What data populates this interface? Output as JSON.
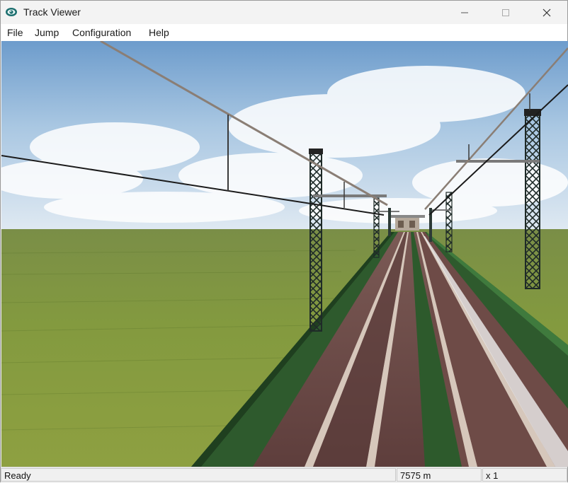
{
  "window": {
    "title": "Track Viewer",
    "icon": "track-viewer-eye-icon",
    "controls": [
      "minimize-icon",
      "maximize-icon",
      "close-icon"
    ]
  },
  "menu": {
    "items": [
      {
        "label": "File"
      },
      {
        "label": "Jump"
      },
      {
        "label": "Configuration"
      },
      {
        "label": "Help"
      }
    ]
  },
  "viewport": {
    "scene": "3d-railway-track-view",
    "colors": {
      "sky_top": "#5d8fc4",
      "sky_bottom": "#d9e6f1",
      "grass": "#7f9a3e",
      "rail": "#c7b7a8",
      "track_bed": "#6a4742",
      "fence": "#2f5a2e",
      "mast": "#2c3a36"
    }
  },
  "status": {
    "message": "Ready",
    "distance": "7575 m",
    "speed": "x 1"
  }
}
